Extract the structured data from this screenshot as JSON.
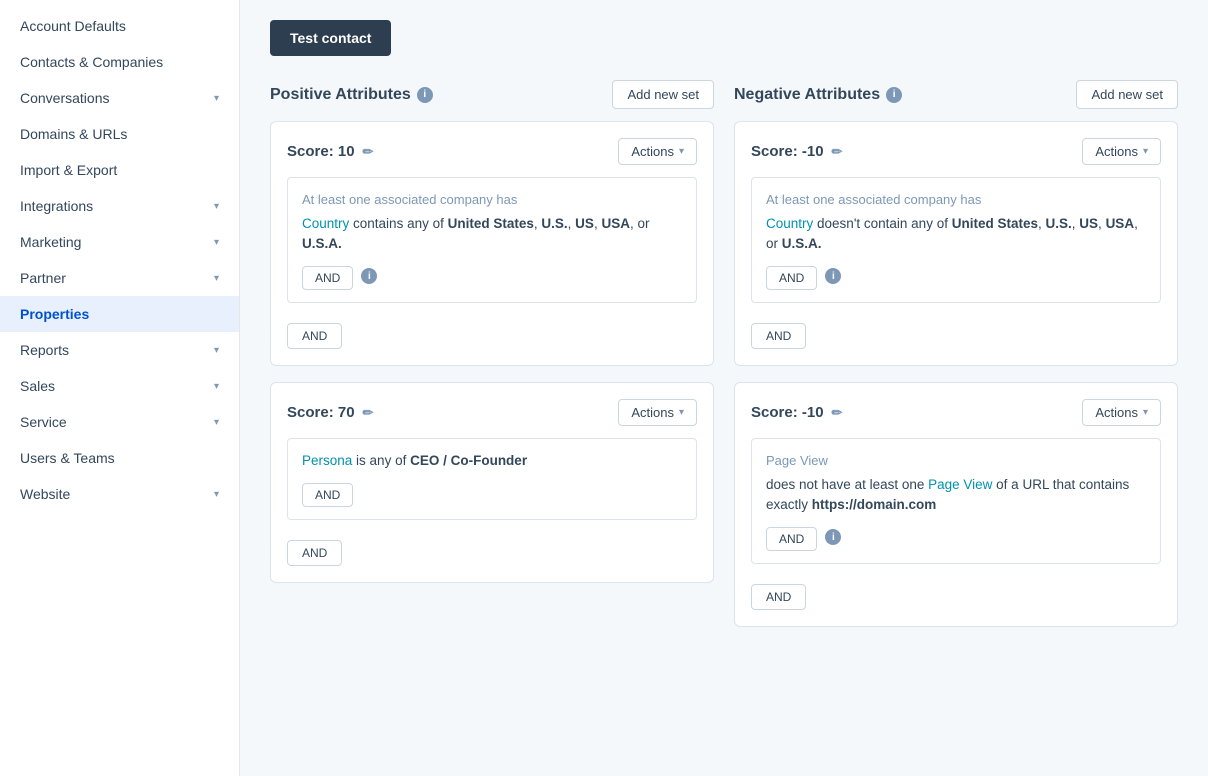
{
  "sidebar": {
    "items": [
      {
        "label": "Account Defaults",
        "hasChevron": false,
        "active": false
      },
      {
        "label": "Contacts & Companies",
        "hasChevron": false,
        "active": false
      },
      {
        "label": "Conversations",
        "hasChevron": true,
        "active": false
      },
      {
        "label": "Domains & URLs",
        "hasChevron": false,
        "active": false
      },
      {
        "label": "Import & Export",
        "hasChevron": false,
        "active": false
      },
      {
        "label": "Integrations",
        "hasChevron": true,
        "active": false
      },
      {
        "label": "Marketing",
        "hasChevron": true,
        "active": false
      },
      {
        "label": "Partner",
        "hasChevron": true,
        "active": false
      },
      {
        "label": "Properties",
        "hasChevron": false,
        "active": true
      },
      {
        "label": "Reports",
        "hasChevron": true,
        "active": false
      },
      {
        "label": "Sales",
        "hasChevron": true,
        "active": false
      },
      {
        "label": "Service",
        "hasChevron": true,
        "active": false
      },
      {
        "label": "Users & Teams",
        "hasChevron": false,
        "active": false
      },
      {
        "label": "Website",
        "hasChevron": true,
        "active": false
      }
    ]
  },
  "header": {
    "test_contact_label": "Test contact"
  },
  "positive_attributes": {
    "title": "Positive Attributes",
    "add_new_set_label": "Add new set",
    "cards": [
      {
        "score_label": "Score: 10",
        "actions_label": "Actions",
        "rule_category": "At least one associated company has",
        "rule_link": "Country",
        "rule_text_before": " contains any of ",
        "rule_bold": "United States, U.S., US, USA,",
        "rule_text_after": " or ",
        "rule_bold2": "U.S.A.",
        "and_inner_label": "AND",
        "and_outer_label": "AND"
      },
      {
        "score_label": "Score: 70",
        "actions_label": "Actions",
        "rule_link": "Persona",
        "rule_text_before": " is any of ",
        "rule_bold": "CEO / Co-Founder",
        "and_inner_label": "AND",
        "and_outer_label": "AND"
      }
    ]
  },
  "negative_attributes": {
    "title": "Negative Attributes",
    "add_new_set_label": "Add new set",
    "cards": [
      {
        "score_label": "Score: -10",
        "actions_label": "Actions",
        "rule_category": "At least one associated company has",
        "rule_link": "Country",
        "rule_text_before": " doesn't contain any of ",
        "rule_bold": "United States, U.S., US, USA,",
        "rule_text_after": " or ",
        "rule_bold2": "U.S.A.",
        "and_inner_label": "AND",
        "and_outer_label": "AND"
      },
      {
        "score_label": "Score: -10",
        "actions_label": "Actions",
        "rule_category": "Page View",
        "rule_text_before": "does not have at least one ",
        "rule_link": "Page View",
        "rule_text_middle": " of a URL that contains exactly ",
        "rule_bold": "https://domain.com",
        "and_inner_label": "AND",
        "and_outer_label": "AND"
      }
    ]
  },
  "icons": {
    "chevron_down": "▾",
    "edit_pencil": "✏",
    "dropdown_arrow": "▾",
    "info": "i"
  }
}
